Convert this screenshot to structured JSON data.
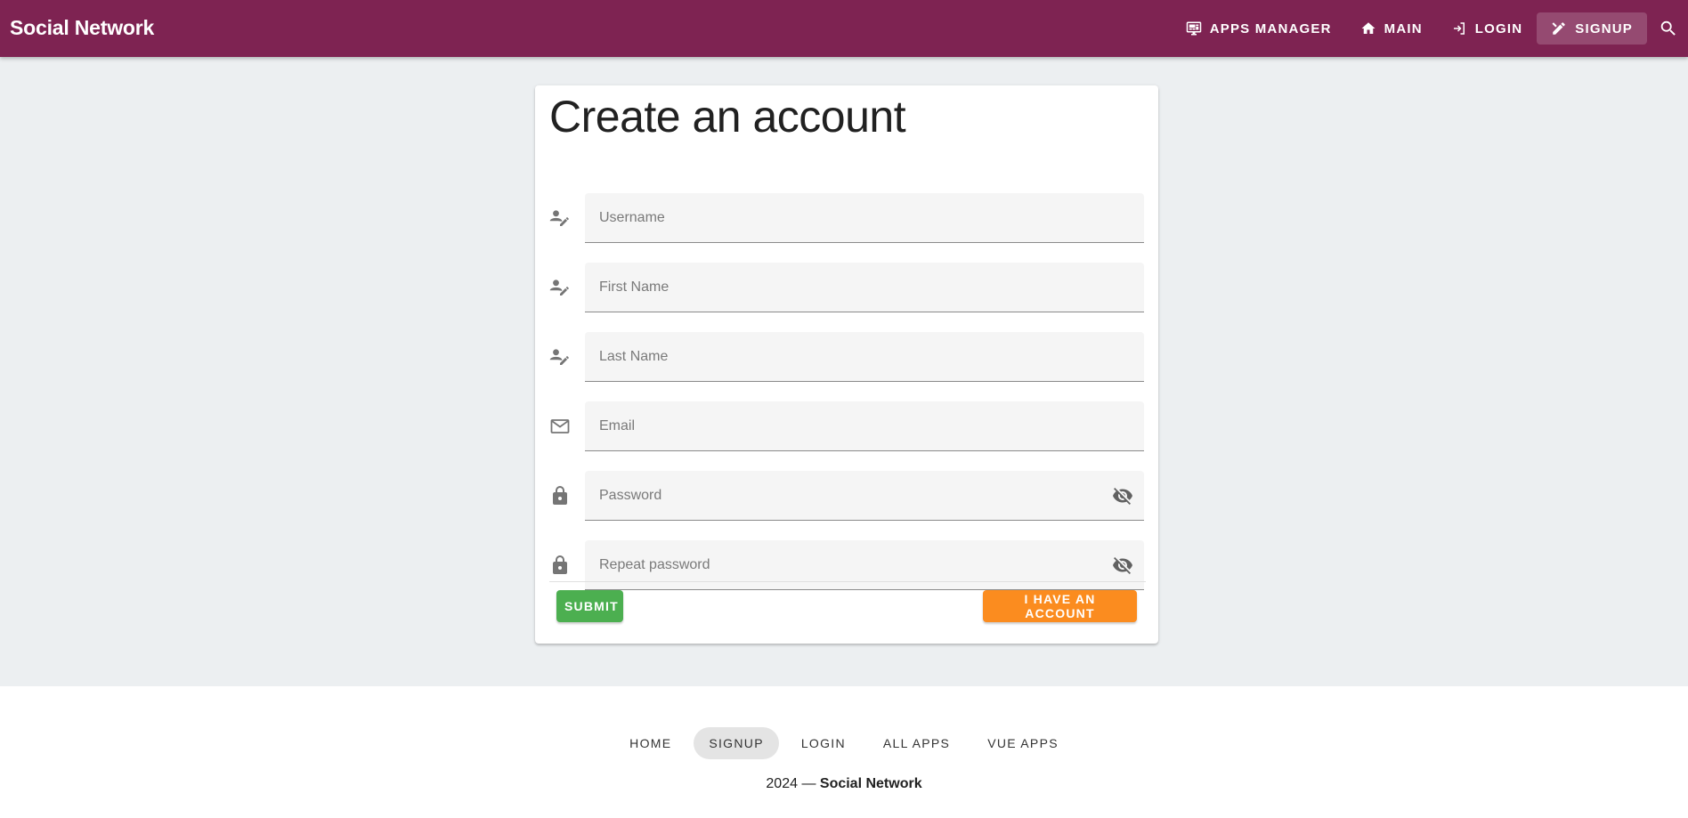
{
  "header": {
    "brand": "Social Network",
    "nav": [
      {
        "label": "APPS MANAGER",
        "icon": "monitor-dashboard-icon"
      },
      {
        "label": "MAIN",
        "icon": "home-icon"
      },
      {
        "label": "LOGIN",
        "icon": "login-icon"
      },
      {
        "label": "SIGNUP",
        "icon": "pencil-ruler-icon",
        "active": true
      }
    ],
    "search_icon": "search-icon"
  },
  "form": {
    "title": "Create an account",
    "fields": [
      {
        "placeholder": "Username",
        "value": "",
        "icon": "account-edit-icon"
      },
      {
        "placeholder": "First Name",
        "value": "",
        "icon": "account-edit-icon"
      },
      {
        "placeholder": "Last Name",
        "value": "",
        "icon": "account-edit-icon"
      },
      {
        "placeholder": "Email",
        "value": "",
        "icon": "email-outline-icon"
      },
      {
        "placeholder": "Password",
        "value": "",
        "icon": "lock-icon",
        "append_icon": "eye-off-icon"
      },
      {
        "placeholder": "Repeat password",
        "value": "",
        "icon": "lock-icon",
        "append_icon": "eye-off-icon"
      }
    ],
    "submit_label": "SUBMIT",
    "account_label": "I HAVE AN ACCOUNT"
  },
  "footer": {
    "links": [
      "HOME",
      "SIGNUP",
      "LOGIN",
      "ALL APPS",
      "VUE APPS"
    ],
    "active_link": "SIGNUP",
    "year_text": "2024 — ",
    "brand": "Social Network"
  },
  "colors": {
    "appbar": "#7e2352",
    "background": "#eceff1",
    "submit": "#4caf50",
    "account": "#fb8c1f"
  }
}
